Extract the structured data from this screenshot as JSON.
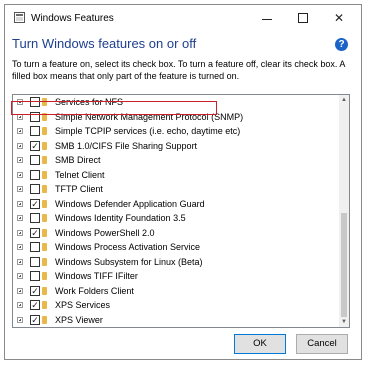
{
  "window": {
    "title": "Windows Features",
    "icon": "windows-features-icon",
    "controls": {
      "minimize": "minimize-icon",
      "maximize": "maximize-icon",
      "close": "✕"
    }
  },
  "heading": "Turn Windows features on or off",
  "help_icon": "?",
  "description": "To turn a feature on, select its check box. To turn a feature off, clear its check box. A filled box means that only part of the feature is turned on.",
  "features": [
    {
      "label": "Services for NFS",
      "checked": false
    },
    {
      "label": "Simple Network Management Protocol (SNMP)",
      "checked": false
    },
    {
      "label": "Simple TCPIP services (i.e. echo, daytime etc)",
      "checked": false
    },
    {
      "label": "SMB 1.0/CIFS File Sharing Support",
      "checked": true
    },
    {
      "label": "SMB Direct",
      "checked": false
    },
    {
      "label": "Telnet Client",
      "checked": false
    },
    {
      "label": "TFTP Client",
      "checked": false
    },
    {
      "label": "Windows Defender Application Guard",
      "checked": true,
      "highlighted": true
    },
    {
      "label": "Windows Identity Foundation 3.5",
      "checked": false
    },
    {
      "label": "Windows PowerShell 2.0",
      "checked": true
    },
    {
      "label": "Windows Process Activation Service",
      "checked": false
    },
    {
      "label": "Windows Subsystem for Linux (Beta)",
      "checked": false
    },
    {
      "label": "Windows TIFF IFilter",
      "checked": false
    },
    {
      "label": "Work Folders Client",
      "checked": true
    },
    {
      "label": "XPS Services",
      "checked": true
    },
    {
      "label": "XPS Viewer",
      "checked": true
    }
  ],
  "checkmark": "✓",
  "buttons": {
    "ok": "OK",
    "cancel": "Cancel"
  },
  "colors": {
    "heading": "#1f3f8f",
    "highlight": "#c9202a",
    "help": "#1a64c8",
    "folder": "#e8b84a"
  }
}
